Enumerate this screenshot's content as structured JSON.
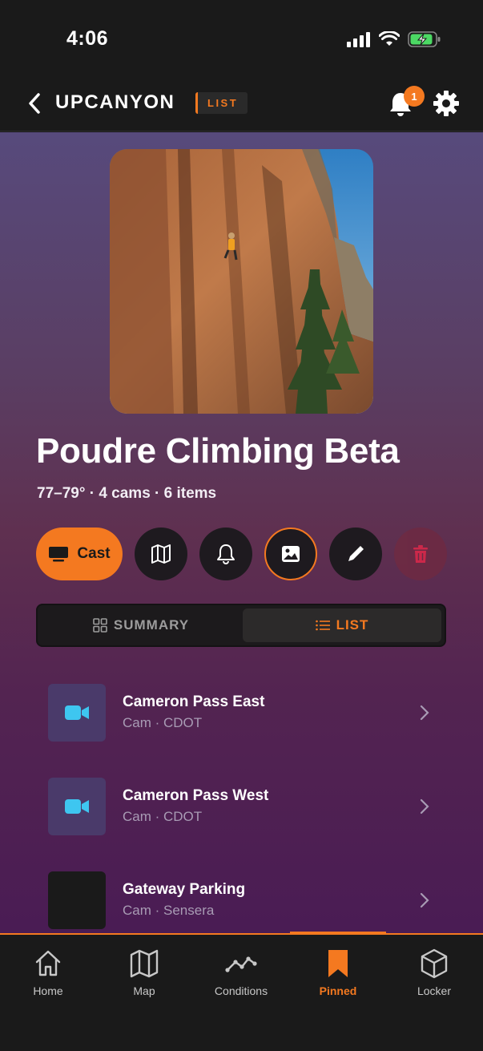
{
  "status_bar": {
    "time": "4:06"
  },
  "header": {
    "title": "UPCANYON",
    "mode_badge": "LIST",
    "notification_count": "1"
  },
  "list": {
    "title": "Poudre Climbing Beta",
    "meta": "77–79° · 4 cams · 6 items"
  },
  "actions": {
    "cast_label": "Cast",
    "buttons": [
      "map-icon",
      "bell-icon",
      "image-icon",
      "pencil-icon",
      "trash-icon"
    ]
  },
  "segmented": {
    "summary_label": "SUMMARY",
    "list_label": "LIST",
    "selected": "LIST"
  },
  "items": [
    {
      "title": "Cameron Pass East",
      "subtitle": "Cam · CDOT",
      "icon": "video-icon"
    },
    {
      "title": "Cameron Pass West",
      "subtitle": "Cam · CDOT",
      "icon": "video-icon"
    },
    {
      "title": "Gateway Parking",
      "subtitle": "Cam · Sensera",
      "icon": ""
    }
  ],
  "tabbar": {
    "tabs": [
      {
        "label": "Home",
        "icon": "home-icon"
      },
      {
        "label": "Map",
        "icon": "map-icon"
      },
      {
        "label": "Conditions",
        "icon": "chart-icon"
      },
      {
        "label": "Pinned",
        "icon": "bookmark-icon"
      },
      {
        "label": "Locker",
        "icon": "box-icon"
      }
    ],
    "active": "Pinned"
  },
  "colors": {
    "accent": "#f47920",
    "camera_icon": "#3ec6f0",
    "danger": "#e0284a"
  }
}
